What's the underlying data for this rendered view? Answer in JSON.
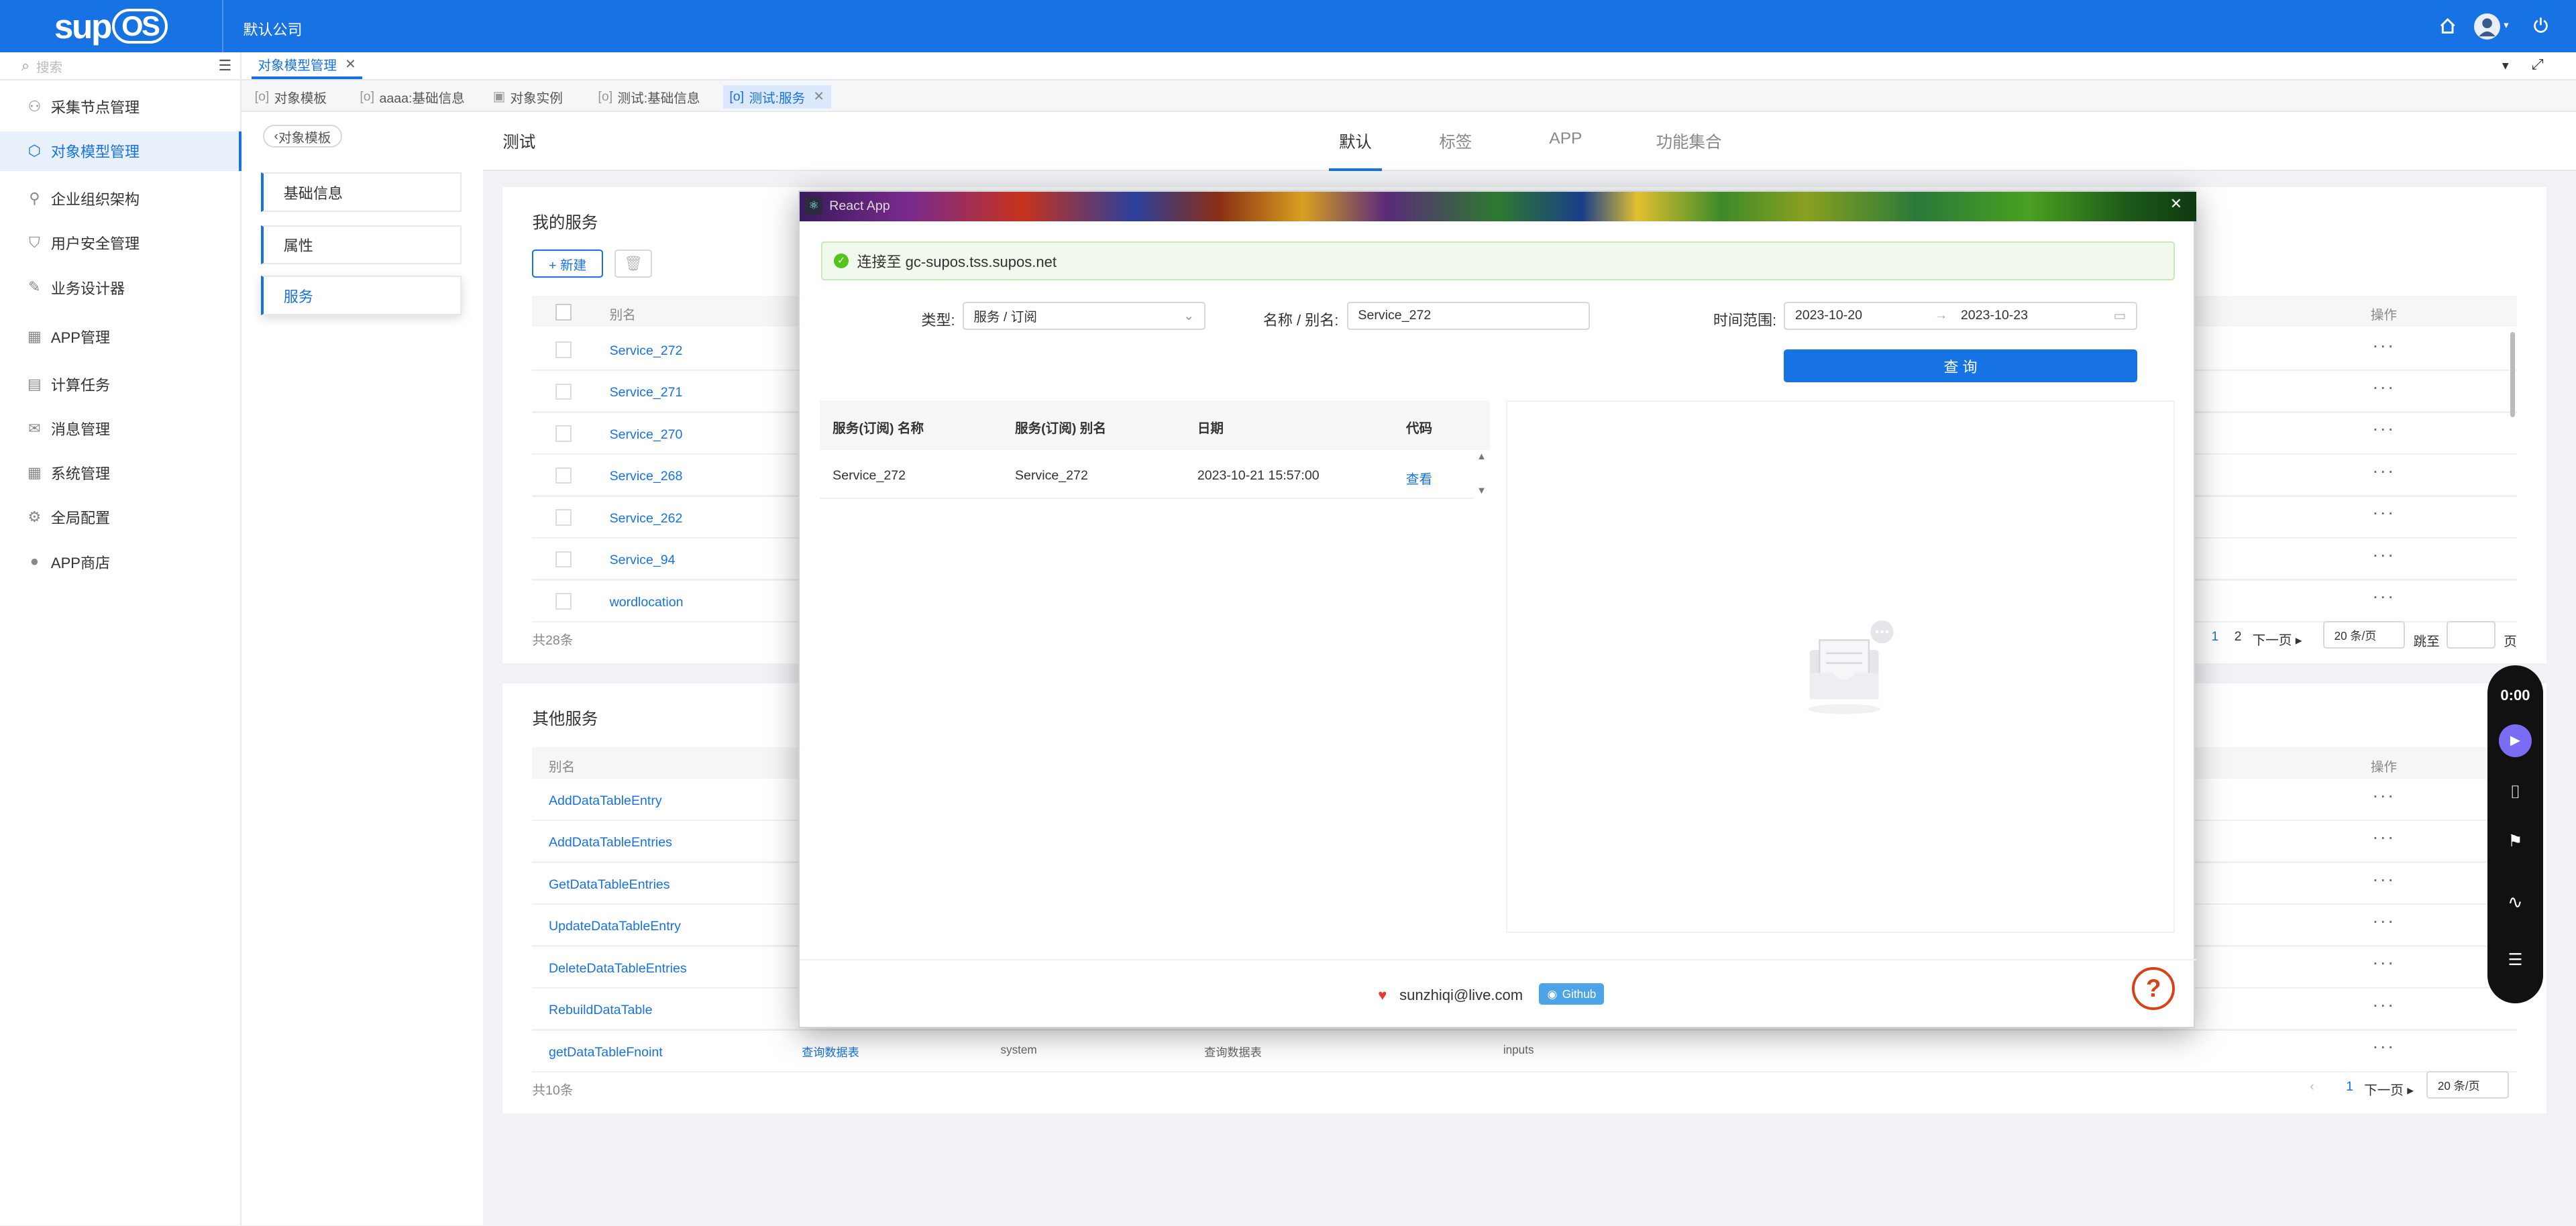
{
  "header": {
    "logo_text": "sup",
    "logo_os": "OS",
    "company": "默认公司",
    "icons": [
      "home-icon",
      "avatar",
      "power-icon"
    ]
  },
  "sidebar": {
    "search_placeholder": "搜索",
    "items": [
      {
        "label": "采集节点管理",
        "icon": "node-icon"
      },
      {
        "label": "对象模型管理",
        "icon": "cube-icon",
        "active": true
      },
      {
        "label": "企业组织架构",
        "icon": "org-icon"
      },
      {
        "label": "用户安全管理",
        "icon": "shield-icon"
      },
      {
        "label": "业务设计器",
        "icon": "design-icon"
      },
      {
        "label": "APP管理",
        "icon": "grid-icon"
      },
      {
        "label": "计算任务",
        "icon": "calc-icon"
      },
      {
        "label": "消息管理",
        "icon": "message-icon"
      },
      {
        "label": "系统管理",
        "icon": "grid-icon"
      },
      {
        "label": "全局配置",
        "icon": "gear-icon"
      },
      {
        "label": "APP商店",
        "icon": "store-icon"
      }
    ]
  },
  "tabs_main": {
    "active": "对象模型管理"
  },
  "tabs_sub": [
    {
      "label": "对象模板"
    },
    {
      "label": "aaaa:基础信息"
    },
    {
      "label": "对象实例"
    },
    {
      "label": "测试:基础信息"
    },
    {
      "label": "测试:服务",
      "active": true
    }
  ],
  "left_panel": {
    "back": "对象模板",
    "items": [
      "基础信息",
      "属性",
      "服务"
    ]
  },
  "content": {
    "title": "测试",
    "tabs": [
      "默认",
      "标签",
      "APP",
      "功能集合"
    ],
    "my_services": {
      "title": "我的服务",
      "new_button": "+ 新建",
      "col_name": "别名",
      "col_action": "操作",
      "rows": [
        "Service_272",
        "Service_271",
        "Service_270",
        "Service_268",
        "Service_262",
        "Service_94",
        "wordlocation"
      ],
      "total": "共28条",
      "pager": {
        "p1": "1",
        "p2": "2",
        "next": "下一页",
        "size": "20 条/页",
        "goto": "跳至",
        "page": "页"
      }
    },
    "other_services": {
      "title": "其他服务",
      "col_name": "别名",
      "col_action": "操作",
      "rows": [
        "AddDataTableEntry",
        "AddDataTableEntries",
        "GetDataTableEntries",
        "UpdateDataTableEntry",
        "DeleteDataTableEntries",
        "RebuildDataTable",
        "getDataTableFnoint"
      ],
      "tail_row": [
        "查询数据表",
        "system",
        "查询数据表",
        "inputs"
      ],
      "total": "共10条",
      "pager": {
        "p1": "1",
        "next": "下一页",
        "size": "20 条/页"
      }
    }
  },
  "modal": {
    "title": "React App",
    "connected": "连接至 gc-supos.tss.supos.net",
    "type_label": "类型:",
    "type_value": "服务 / 订阅",
    "name_label": "名称 / 别名:",
    "name_value": "Service_272",
    "time_label": "时间范围:",
    "date_from": "2023-10-20",
    "date_to": "2023-10-23",
    "query_button": "查 询",
    "table": {
      "headers": [
        "服务(订阅) 名称",
        "服务(订阅) 别名",
        "日期",
        "代码"
      ],
      "rows": [
        [
          "Service_272",
          "Service_272",
          "2023-10-21 15:57:00",
          "查看"
        ]
      ]
    },
    "footer_email": "sunzhiqi@live.com",
    "footer_github": "Github"
  },
  "recorder": {
    "time": "0:00"
  }
}
